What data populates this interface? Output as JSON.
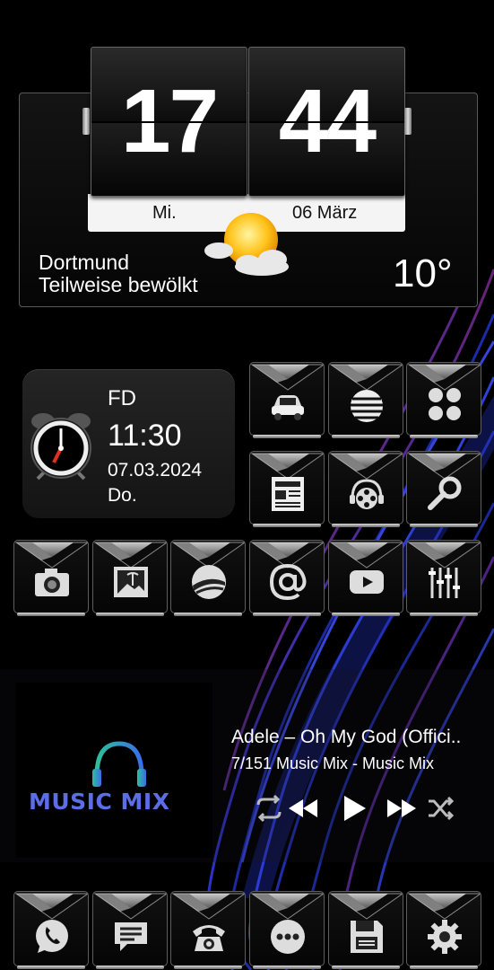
{
  "clock": {
    "hours": "17",
    "minutes": "44",
    "day": "Mi.",
    "date": "06 März"
  },
  "weather": {
    "city": "Dortmund",
    "condition": "Teilweise bewölkt",
    "temperature": "10°",
    "icon": "partly-cloudy-sun-icon"
  },
  "alarm": {
    "name": "FD",
    "time": "11:30",
    "date": "07.03.2024",
    "weekday": "Do.",
    "icon": "alarm-clock-icon"
  },
  "apps_row1": [
    {
      "name": "car-icon"
    },
    {
      "name": "att-globe-icon"
    },
    {
      "name": "app-drawer-dots-icon"
    }
  ],
  "apps_row2": [
    {
      "name": "newspaper-icon"
    },
    {
      "name": "headphones-film-icon"
    },
    {
      "name": "wrench-icon"
    }
  ],
  "apps_row3": [
    {
      "name": "camera-icon"
    },
    {
      "name": "gallery-icon"
    },
    {
      "name": "google-earth-icon"
    },
    {
      "name": "email-at-icon"
    },
    {
      "name": "youtube-icon"
    },
    {
      "name": "equalizer-icon"
    }
  ],
  "music": {
    "cover_text": "MUSIC MIX",
    "title": "Adele – Oh My God (Offici..",
    "info": "7/151  Music Mix - Music Mix",
    "controls": [
      "repeat-icon",
      "previous-icon",
      "play-icon",
      "next-icon",
      "shuffle-icon"
    ]
  },
  "dock": [
    {
      "name": "whatsapp-icon"
    },
    {
      "name": "messages-icon"
    },
    {
      "name": "phone-icon"
    },
    {
      "name": "apps-icon"
    },
    {
      "name": "save-icon"
    },
    {
      "name": "settings-gear-icon"
    }
  ],
  "colors": {
    "accent_blue": "#5b6ee8",
    "background": "#000000"
  }
}
